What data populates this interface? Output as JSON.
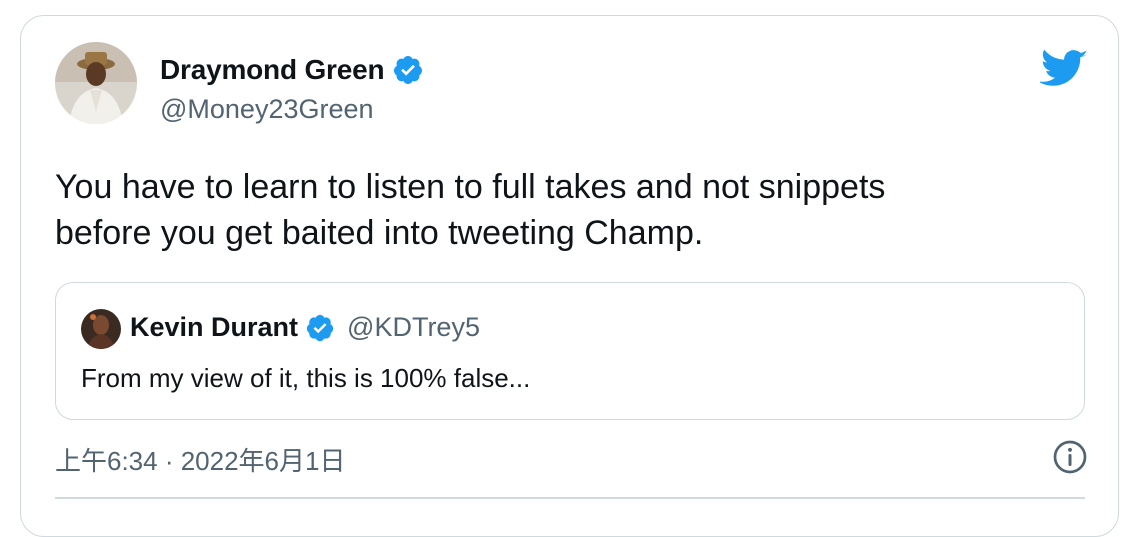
{
  "author": {
    "name": "Draymond Green",
    "handle": "@Money23Green",
    "verified": true
  },
  "tweet": {
    "text_line1": "You have to learn to listen to full takes and not snippets",
    "text_line2": "before you get baited into tweeting Champ.",
    "timestamp": "上午6:34 · 2022年6月1日"
  },
  "quoted_tweet": {
    "name": "Kevin Durant",
    "handle": "@KDTrey5",
    "verified": true,
    "text": "From my view of it, this is 100% false..."
  },
  "icons": {
    "brand": "twitter-bird-icon",
    "verified": "verified-badge-icon",
    "info": "info-icon"
  },
  "colors": {
    "brand_blue": "#1d9bf0",
    "text_primary": "#0f1419",
    "text_secondary": "#536471",
    "border": "#cfd9de"
  }
}
